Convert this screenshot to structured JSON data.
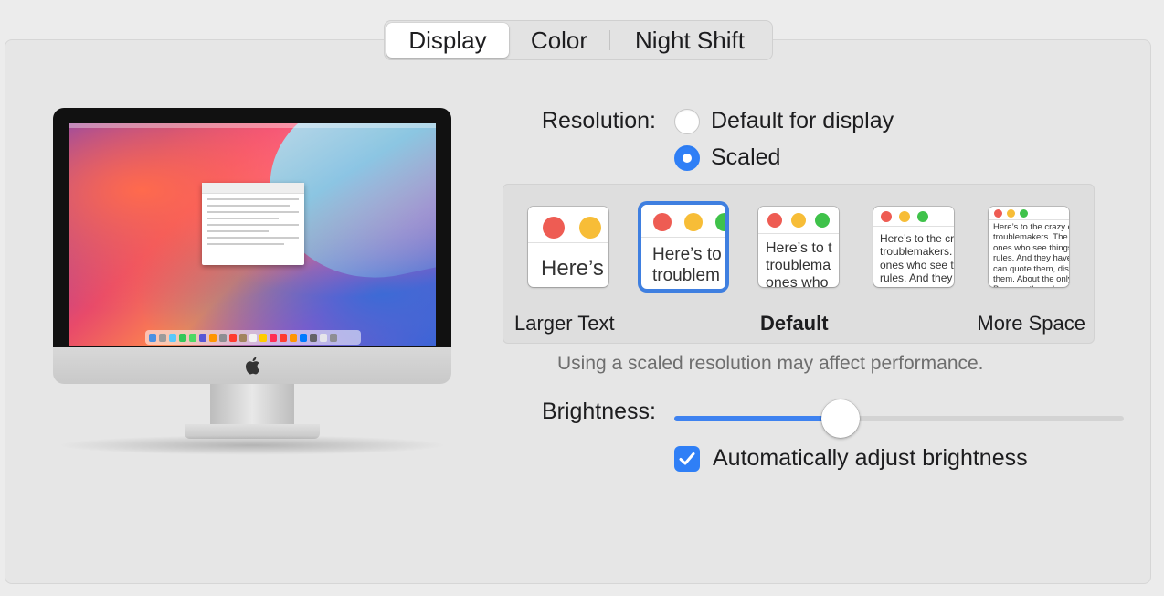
{
  "tabs": [
    {
      "label": "Display",
      "active": true
    },
    {
      "label": "Color",
      "active": false
    },
    {
      "label": "Night Shift",
      "active": false
    }
  ],
  "resolution": {
    "label": "Resolution:",
    "options": [
      {
        "label": "Default for display",
        "selected": false
      },
      {
        "label": "Scaled",
        "selected": true
      }
    ]
  },
  "scaling": {
    "previews": [
      {
        "text": "Here’s",
        "selected": false
      },
      {
        "text": "Here’s to\ntroublem",
        "selected": true
      },
      {
        "text": "Here’s to t\ntroublema\nones who",
        "selected": false
      },
      {
        "text": "Here’s to the cr\ntroublemakers.\nones who see t\nrules. And they",
        "selected": false
      },
      {
        "text": "Here’s to the crazy one\ntroublemakers. The rou\nones who see things dif\nrules. And they have no\ncan quote them, disagre\nthem. About the only th\nBecause they change th",
        "selected": false
      }
    ],
    "left_label": "Larger Text",
    "center_label": "Default",
    "right_label": "More Space"
  },
  "performance_note": "Using a scaled resolution may affect performance.",
  "brightness": {
    "label": "Brightness:",
    "value_fraction": 0.37
  },
  "auto_brightness": {
    "label": "Automatically adjust brightness",
    "checked": true
  },
  "colors": {
    "accent": "#2f7ff6",
    "selection_ring": "#3f7fe0"
  },
  "icons": {
    "apple_logo": "apple-logo-icon",
    "checkmark": "checkmark-icon"
  }
}
